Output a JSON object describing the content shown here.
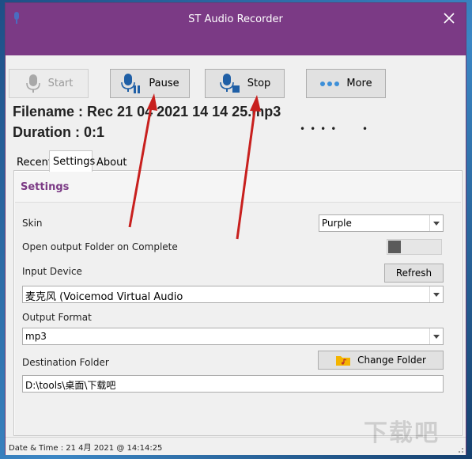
{
  "window": {
    "title": "ST Audio Recorder"
  },
  "toolbar": {
    "start_label": "Start",
    "pause_label": "Pause",
    "stop_label": "Stop",
    "more_label": "More"
  },
  "recording": {
    "filename_line": "Filename : Rec 21 04 2021 14 14 25.mp3",
    "duration_line": "Duration : 0:1",
    "level_dots": "••••",
    "level_dot_single": "•"
  },
  "tabs": [
    {
      "label": "Recent"
    },
    {
      "label": "Settings"
    },
    {
      "label": "About"
    }
  ],
  "settings": {
    "panel_title": "Settings",
    "skin_label": "Skin",
    "skin_value": "Purple",
    "open_folder_label": "Open output Folder on Complete",
    "open_folder_enabled": false,
    "input_device_label": "Input Device",
    "refresh_label": "Refresh",
    "input_device_value": "麦克风 (Voicemod Virtual Audio",
    "output_format_label": "Output Format",
    "output_format_value": "mp3",
    "destination_label": "Destination Folder",
    "change_folder_label": "Change Folder",
    "destination_value": "D:\\tools\\桌面\\下载吧"
  },
  "status": {
    "text": "Date & Time : 21 4月 2021 @ 14:14:25"
  },
  "watermark": {
    "text": "下载吧"
  },
  "colors": {
    "titlebar": "#7b3a85",
    "accent_purple": "#7b3a85",
    "mic_blue": "#1f5fa6",
    "annotation_red": "#c8201e"
  }
}
